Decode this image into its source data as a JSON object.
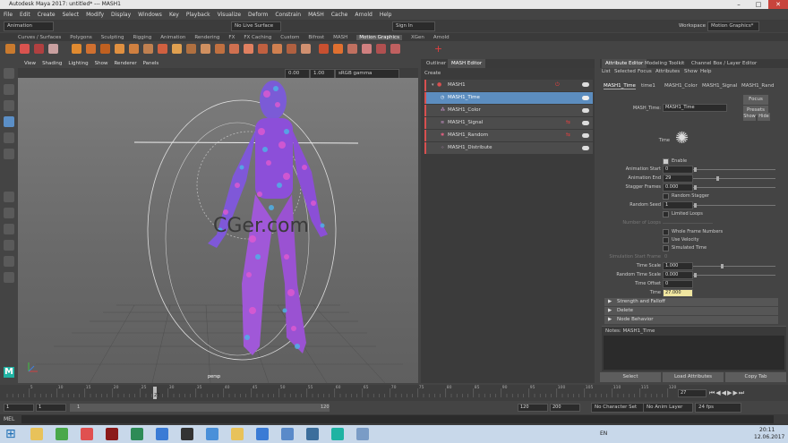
{
  "window": {
    "title": "Autodesk Maya 2017: untitled*  ---  MASH1",
    "min": "–",
    "max": "□",
    "close": "✕"
  },
  "menu": [
    "File",
    "Edit",
    "Create",
    "Select",
    "Modify",
    "Display",
    "Windows",
    "Key",
    "Playback",
    "Visualize",
    "Deform",
    "Constrain",
    "MASH",
    "Cache",
    "Arnold",
    "Help"
  ],
  "status": {
    "mode": "Animation",
    "live": "No Live Surface",
    "signin": "Sign In",
    "workspace_label": "Workspace :",
    "workspace": "Motion Graphics*"
  },
  "shelf_tabs": [
    "Curves / Surfaces",
    "Polygons",
    "Sculpting",
    "Rigging",
    "Animation",
    "Rendering",
    "FX",
    "FX Caching",
    "Custom",
    "Bifrost",
    "MASH",
    "Motion Graphics",
    "XGen",
    "Arnold"
  ],
  "shelf_active": "Motion Graphics",
  "viewport": {
    "menu": [
      "View",
      "Shading",
      "Lighting",
      "Show",
      "Renderer",
      "Panels"
    ],
    "val1": "0.00",
    "val2": "1.00",
    "colorspace": "sRGB gamma",
    "camera": "persp",
    "watermark": "CGer.com"
  },
  "outliner": {
    "tabs": [
      "Outliner",
      "MASH Editor"
    ],
    "create": "Create",
    "network": "MASH1",
    "nodes": [
      {
        "name": "MASH1_Time",
        "selected": true
      },
      {
        "name": "MASH1_Color",
        "selected": false
      },
      {
        "name": "MASH1_Signal",
        "selected": false
      },
      {
        "name": "MASH1_Random",
        "selected": false
      },
      {
        "name": "MASH1_Distribute",
        "selected": false
      }
    ]
  },
  "attr": {
    "tabs": [
      "Attribute Editor",
      "Modeling Toolkit",
      "Channel Box / Layer Editor"
    ],
    "menu": [
      "List",
      "Selected",
      "Focus",
      "Attributes",
      "Show",
      "Help"
    ],
    "node_tabs": [
      "MASH1_Time",
      "time1",
      "MASH1_Color",
      "MASH1_Signal",
      "MASH1_Rand"
    ],
    "node_label": "MASH_Time:",
    "node_value": "MASH1_Time",
    "focus": "Focus",
    "presets": "Presets",
    "show": "Show",
    "hide": "Hide",
    "time_label": "Time",
    "enable": "Enable",
    "anim_start_label": "Animation Start",
    "anim_start": "0",
    "anim_end_label": "Animation End",
    "anim_end": "29",
    "stagger_label": "Stagger Frames",
    "stagger": "0.000",
    "random_stagger": "Random Stagger",
    "seed_label": "Random Seed",
    "seed": "1",
    "limited_loops": "Limited Loops",
    "num_loops": "Number of Loops",
    "whole_frames": "Whole Frame Numbers",
    "use_velocity": "Use Velocity",
    "sim_time": "Simulated Time",
    "sim_start": "Simulation Start Frame",
    "time_scale_label": "Time Scale",
    "time_scale": "1.000",
    "rand_scale_label": "Random Time Scale",
    "rand_scale": "0.000",
    "time_offset_label": "Time Offset",
    "time_offset": "0",
    "time_value_label": "Time",
    "time_value": "27.000",
    "sections": [
      "Strength and Falloff",
      "Delete",
      "Node Behavior"
    ],
    "notes": "Notes:  MASH1_Time",
    "buttons": [
      "Select",
      "Load Attributes",
      "Copy Tab"
    ]
  },
  "timeline": {
    "ticks": [
      "5",
      "10",
      "15",
      "20",
      "25",
      "30",
      "35",
      "40",
      "45",
      "50",
      "55",
      "60",
      "65",
      "70",
      "75",
      "80",
      "85",
      "90",
      "95",
      "100",
      "105",
      "110",
      "115",
      "120"
    ],
    "current": "27",
    "frame_field": "27",
    "start": "1",
    "start2": "1",
    "range_mark": "1",
    "range_end": "120",
    "end": "120",
    "end2": "200",
    "char_set": "No Character Set",
    "anim_layer": "No Anim Layer",
    "fps": "24 fps"
  },
  "cmd": {
    "lang": "MEL"
  },
  "taskbar": {
    "lang": "EN",
    "time": "20:11",
    "date": "12.06.2017"
  }
}
